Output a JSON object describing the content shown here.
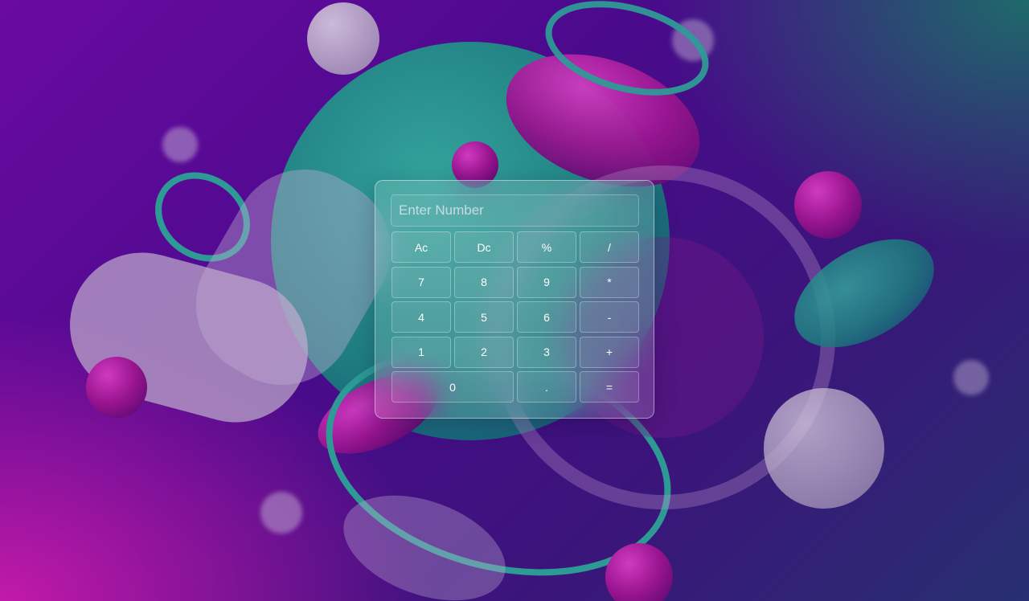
{
  "calculator": {
    "display": {
      "value": "",
      "placeholder": "Enter Number"
    },
    "keys": [
      {
        "label": "Ac",
        "name": "key-all-clear"
      },
      {
        "label": "Dc",
        "name": "key-delete"
      },
      {
        "label": "%",
        "name": "key-percent"
      },
      {
        "label": "/",
        "name": "key-divide"
      },
      {
        "label": "7",
        "name": "key-7"
      },
      {
        "label": "8",
        "name": "key-8"
      },
      {
        "label": "9",
        "name": "key-9"
      },
      {
        "label": "*",
        "name": "key-multiply"
      },
      {
        "label": "4",
        "name": "key-4"
      },
      {
        "label": "5",
        "name": "key-5"
      },
      {
        "label": "6",
        "name": "key-6"
      },
      {
        "label": "-",
        "name": "key-subtract"
      },
      {
        "label": "1",
        "name": "key-1"
      },
      {
        "label": "2",
        "name": "key-2"
      },
      {
        "label": "3",
        "name": "key-3"
      },
      {
        "label": "+",
        "name": "key-add"
      },
      {
        "label": "0",
        "name": "key-0"
      },
      {
        "label": ".",
        "name": "key-decimal"
      },
      {
        "label": "=",
        "name": "key-equals"
      }
    ]
  },
  "theme": {
    "background_primary": "#4a0a8c",
    "background_magenta": "#c21aa8",
    "background_teal": "#1e6a6a",
    "shape_teal": "#2a8a8a",
    "shape_magenta": "#9a1a9a",
    "key_text": "#ffffff"
  }
}
